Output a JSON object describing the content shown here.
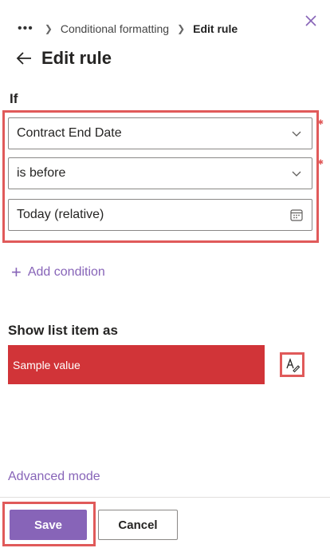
{
  "breadcrumb": {
    "more": "•••",
    "items": [
      "Conditional formatting",
      "Edit rule"
    ]
  },
  "header": {
    "title": "Edit rule"
  },
  "rule": {
    "if_label": "If",
    "field": "Contract End Date",
    "operator": "is before",
    "value": "Today (relative)"
  },
  "actions": {
    "add_condition": "Add condition",
    "show_label": "Show list item as",
    "sample_value": "Sample value",
    "advanced_mode": "Advanced mode",
    "save": "Save",
    "cancel": "Cancel"
  },
  "colors": {
    "accent": "#8764b8",
    "sample_bg": "#d13438",
    "highlight": "#e05a5a"
  },
  "icons": [
    "more-icon",
    "chevron-right-icon",
    "close-icon",
    "back-arrow-icon",
    "chevron-down-icon",
    "calendar-icon",
    "plus-icon",
    "format-edit-icon"
  ]
}
